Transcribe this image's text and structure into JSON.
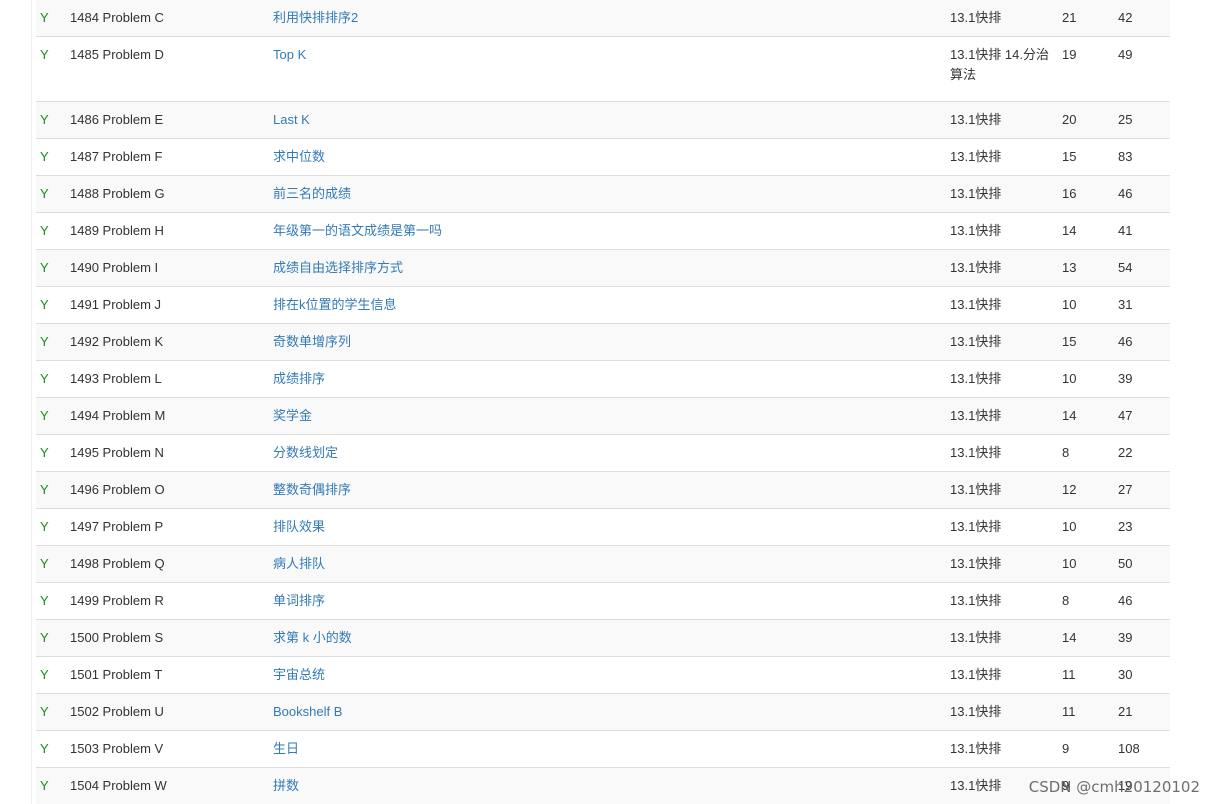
{
  "rows": [
    {
      "status": "Y",
      "id": "1484 Problem  C",
      "title": "利用快排排序2",
      "source": "13.1快排",
      "ac": "21",
      "sub": "42"
    },
    {
      "status": "Y",
      "id": "1485 Problem  D",
      "title": "Top K",
      "source": "13.1快排 14.分治算法",
      "ac": "19",
      "sub": "49"
    },
    {
      "status": "Y",
      "id": "1486 Problem  E",
      "title": "Last K",
      "source": "13.1快排",
      "ac": "20",
      "sub": "25"
    },
    {
      "status": "Y",
      "id": "1487 Problem  F",
      "title": "求中位数",
      "source": "13.1快排",
      "ac": "15",
      "sub": "83"
    },
    {
      "status": "Y",
      "id": "1488 Problem  G",
      "title": "前三名的成绩",
      "source": "13.1快排",
      "ac": "16",
      "sub": "46"
    },
    {
      "status": "Y",
      "id": "1489 Problem  H",
      "title": "年级第一的语文成绩是第一吗",
      "source": "13.1快排",
      "ac": "14",
      "sub": "41"
    },
    {
      "status": "Y",
      "id": "1490 Problem  I",
      "title": "成绩自由选择排序方式",
      "source": "13.1快排",
      "ac": "13",
      "sub": "54"
    },
    {
      "status": "Y",
      "id": "1491 Problem  J",
      "title": "排在k位置的学生信息",
      "source": "13.1快排",
      "ac": "10",
      "sub": "31"
    },
    {
      "status": "Y",
      "id": "1492 Problem  K",
      "title": "奇数单增序列",
      "source": "13.1快排",
      "ac": "15",
      "sub": "46"
    },
    {
      "status": "Y",
      "id": "1493 Problem  L",
      "title": "成绩排序",
      "source": "13.1快排",
      "ac": "10",
      "sub": "39"
    },
    {
      "status": "Y",
      "id": "1494 Problem  M",
      "title": "奖学金",
      "source": "13.1快排",
      "ac": "14",
      "sub": "47"
    },
    {
      "status": "Y",
      "id": "1495 Problem  N",
      "title": "分数线划定",
      "source": "13.1快排",
      "ac": "8",
      "sub": "22"
    },
    {
      "status": "Y",
      "id": "1496 Problem  O",
      "title": "整数奇偶排序",
      "source": "13.1快排",
      "ac": "12",
      "sub": "27"
    },
    {
      "status": "Y",
      "id": "1497 Problem  P",
      "title": "排队效果",
      "source": "13.1快排",
      "ac": "10",
      "sub": "23"
    },
    {
      "status": "Y",
      "id": "1498 Problem  Q",
      "title": "病人排队",
      "source": "13.1快排",
      "ac": "10",
      "sub": "50"
    },
    {
      "status": "Y",
      "id": "1499 Problem  R",
      "title": "单词排序",
      "source": "13.1快排",
      "ac": "8",
      "sub": "46"
    },
    {
      "status": "Y",
      "id": "1500 Problem  S",
      "title": "求第 k 小的数",
      "source": "13.1快排",
      "ac": "14",
      "sub": "39"
    },
    {
      "status": "Y",
      "id": "1501 Problem  T",
      "title": "宇宙总统",
      "source": "13.1快排",
      "ac": "11",
      "sub": "30"
    },
    {
      "status": "Y",
      "id": "1502 Problem  U",
      "title": "Bookshelf B",
      "source": "13.1快排",
      "ac": "11",
      "sub": "21"
    },
    {
      "status": "Y",
      "id": "1503 Problem  V",
      "title": "生日",
      "source": "13.1快排",
      "ac": "9",
      "sub": "108"
    },
    {
      "status": "Y",
      "id": "1504 Problem  W",
      "title": "拼数",
      "source": "13.1快排",
      "ac": "9",
      "sub": "19"
    }
  ],
  "watermark": "CSDN @cmh20120102",
  "colors": {
    "status_green": "#1a8a1a",
    "link_blue": "#337ab7",
    "row_stripe": "#f9f9f9",
    "row_border": "#dddddd"
  }
}
